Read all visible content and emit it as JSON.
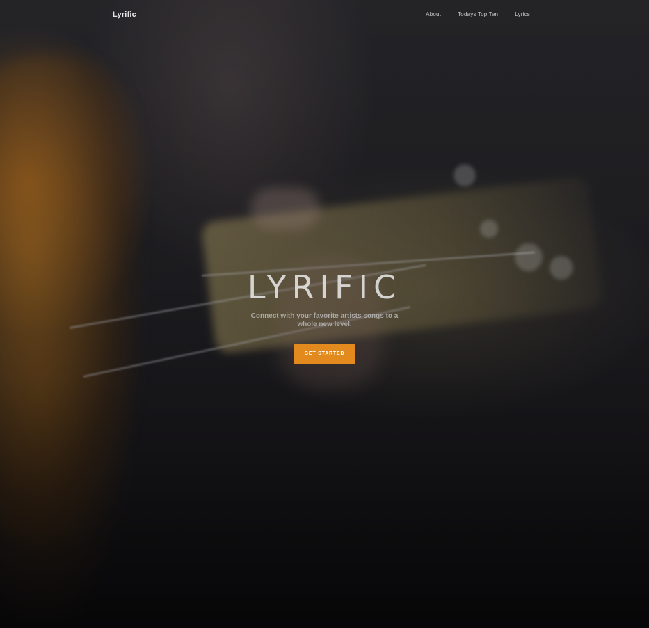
{
  "nav": {
    "brand": "Lyrific",
    "links": [
      {
        "label": "About"
      },
      {
        "label": "Todays Top Ten"
      },
      {
        "label": "Lyrics"
      }
    ]
  },
  "hero": {
    "headline": "LYRIFIC",
    "subtitle": "Connect with your favorite artists songs to a whole new level.",
    "cta_label": "GET STARTED",
    "background_image": "bass-guitar-player-photo"
  },
  "colors": {
    "accent": "#e38a1e",
    "nav_text": "#c9c9c9",
    "brand_text": "#e6e6e6"
  }
}
